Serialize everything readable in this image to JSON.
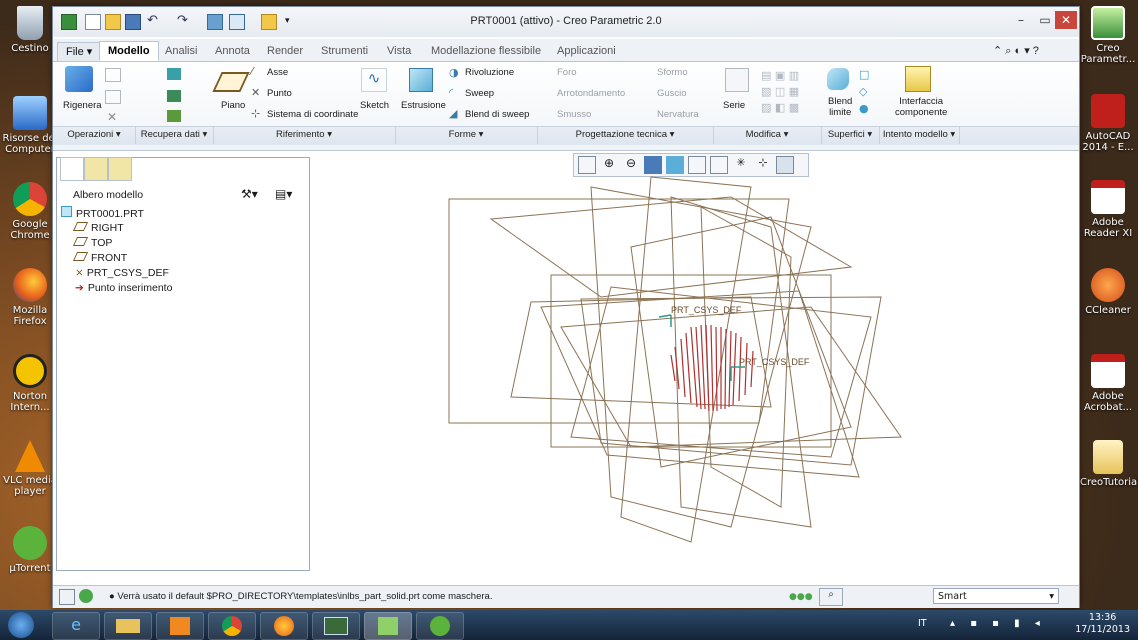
{
  "desktop": {
    "left_icons": [
      {
        "name": "cestino",
        "label": "Cestino"
      },
      {
        "name": "risorse",
        "label": "Risorse del Computer"
      },
      {
        "name": "chrome",
        "label": "Google Chrome"
      },
      {
        "name": "firefox",
        "label": "Mozilla Firefox"
      },
      {
        "name": "norton",
        "label": "Norton Intern..."
      },
      {
        "name": "vlc",
        "label": "VLC media player"
      },
      {
        "name": "utorrent",
        "label": "µTorrent"
      }
    ],
    "right_icons": [
      {
        "name": "creo",
        "label": "Creo Parametr..."
      },
      {
        "name": "autocad",
        "label": "AutoCAD 2014 - E..."
      },
      {
        "name": "adobe-reader",
        "label": "Adobe Reader XI"
      },
      {
        "name": "ccleaner",
        "label": "CCleaner"
      },
      {
        "name": "acrobat",
        "label": "Adobe Acrobat..."
      },
      {
        "name": "creotutorial",
        "label": "CreoTutorial"
      }
    ]
  },
  "window": {
    "title": "PRT0001 (attivo) - Creo Parametric 2.0"
  },
  "tabs": [
    "File ▾",
    "Modello",
    "Analisi",
    "Annota",
    "Render",
    "Strumenti",
    "Vista",
    "Modellazione flessibile",
    "Applicazioni"
  ],
  "ribbon": {
    "rigenera": "Rigenera",
    "piano": "Piano",
    "asse": "Asse",
    "punto": "Punto",
    "sistema": "Sistema di coordinate",
    "sketch": "Sketch",
    "estrusione": "Estrusione",
    "rivoluzione": "Rivoluzione",
    "sweep": "Sweep",
    "blend_sweep": "Blend di sweep",
    "foro": "Foro",
    "arrotondamento": "Arrotondamento",
    "smusso": "Smusso",
    "sformo": "Sformo",
    "guscio": "Guscio",
    "nervatura": "Nervatura",
    "serie": "Serie",
    "blend_limite_1": "Blend",
    "blend_limite_2": "limite",
    "interfaccia_1": "Interfaccia",
    "interfaccia_2": "componente",
    "groups": [
      {
        "label": "Operazioni ▾"
      },
      {
        "label": "Recupera dati ▾"
      },
      {
        "label": "Riferimento ▾"
      },
      {
        "label": "Forme ▾"
      },
      {
        "label": "Progettazione tecnica ▾"
      },
      {
        "label": "Modifica ▾"
      },
      {
        "label": "Superfici ▾"
      },
      {
        "label": "Intento modello ▾"
      }
    ]
  },
  "tree": {
    "header": "Albero modello",
    "items": [
      "PRT0001.PRT",
      "RIGHT",
      "TOP",
      "FRONT",
      "PRT_CSYS_DEF",
      "Punto inserimento"
    ]
  },
  "viewport": {
    "csys_label_1": "PRT_CSYS_DEF",
    "csys_label_2": "PRT_CSYS_DEF"
  },
  "status": {
    "message": "Verrà usato il default $PRO_DIRECTORY\\templates\\inlbs_part_solid.prt come maschera.",
    "filter": "Smart"
  },
  "taskbar": {
    "lang": "IT",
    "time": "13:36",
    "date": "17/11/2013"
  },
  "colors": {
    "plane": "#8b7355",
    "csys": "#b03030",
    "accent": "#2a6ac8"
  }
}
